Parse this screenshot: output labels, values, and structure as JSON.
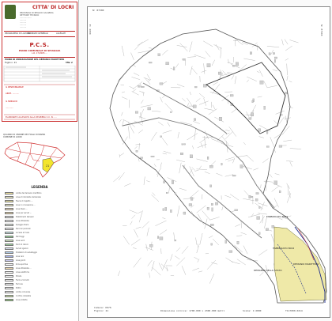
{
  "title_block": {
    "city": "CITTA' DI LOCRI",
    "header_lines": [
      "PROVINCIA DI REGGIO CALABRIA",
      "SETTORE TECNICO",
      "..................",
      "..........",
      "..........",
      "..........",
      ".........."
    ],
    "tabs": [
      "PROGRAMMA DI LAVORO",
      "INDIRIZZI GENERALI",
      "ALLEGATI"
    ],
    "pcs": "P.C.S.",
    "pcs_subtitle": "PIANO COMUNALE DI SPIAGGIA",
    "pcs_law": "L.R. 17/2005 ...",
    "sheet_title": "PIANO DI ZONIZZAZIONE DEL DEMANIO MARITTIMO",
    "sheet_code": "Foglio n. 21",
    "tav": "TAV. 2",
    "red_lines": [
      "IL RESPONSABILE",
      "ARCH. ..........",
      "IL SINDACO",
      "............"
    ],
    "bottom_note": "ELABORATO ALLEGATO ALLA DELIBERA C.C. N. ...."
  },
  "inset": {
    "title_lines": [
      "QUADRO DI UNIONE DEI FOGLI DI MAPPA",
      "COMUNE DI LOCRI"
    ],
    "highlight_label": "21",
    "colors": {
      "highlight": "#f3e52d",
      "outline": "#d03030"
    }
  },
  "legend": {
    "title": "LEGENDA",
    "items": [
      {
        "label": "Limite del demanio marittimo",
        "color": "#f6e9a0"
      },
      {
        "label": "Linea di dividente demaniale",
        "color": "#f4f1c8"
      },
      {
        "label": "Fascia di rispetto ...",
        "color": "#efe7a0"
      },
      {
        "label": "Aree in concessione ...",
        "color": "#f0efc8"
      },
      {
        "label": "Aree libere ...",
        "color": "#f2e2c4"
      },
      {
        "label": "Aree per servizi ...",
        "color": "#e9d6a8"
      },
      {
        "label": "Stabilimenti balneari",
        "color": "#e9e9e9"
      },
      {
        "label": "Aree attrezzate",
        "color": "#ffffff"
      },
      {
        "label": "Spiaggia libera",
        "color": "#e9f2e9"
      },
      {
        "label": "Percorsi pedonali",
        "color": "#ffffff"
      },
      {
        "label": "Accessi al mare",
        "color": "#c8e6e6"
      },
      {
        "label": "Parcheggi",
        "color": "#8fd08f"
      },
      {
        "label": "Aree verdi",
        "color": "#d6eec6"
      },
      {
        "label": "Punti di ristoro",
        "color": "#9fd69f"
      },
      {
        "label": "Servizi igienici",
        "color": "#dfe6f2"
      },
      {
        "label": "Postazioni di salvataggio",
        "color": "#b4d2f0"
      },
      {
        "label": "Area cani",
        "color": "#a8b4e8"
      },
      {
        "label": "Area giochi",
        "color": "#c8c8e8"
      },
      {
        "label": "Zona sportiva",
        "color": "#f0f0f0"
      },
      {
        "label": "Aree attrezzate ...",
        "color": "#ecd6b0"
      },
      {
        "label": "Linee elettriche",
        "color": "#ffffff"
      },
      {
        "label": "Strade",
        "color": "#ffffff"
      },
      {
        "label": "Fiumi e torrenti",
        "color": "#ffffff"
      },
      {
        "label": "Ferrovia",
        "color": "#ffffff"
      },
      {
        "label": "Edifici",
        "color": "#ffffff"
      },
      {
        "label": "Limite comunale",
        "color": "#ffffff"
      },
      {
        "label": "Confine catastale",
        "color": "#cde6a8"
      },
      {
        "label": "Aree protette",
        "color": "#8ec87a"
      }
    ]
  },
  "map": {
    "top_left_label": "N: 87300",
    "left_coord": "E: 4000",
    "right_top_coord": "N: 87300",
    "bottom_left": [
      "Comune: D976",
      "Foglio: 21"
    ],
    "bottom_center": "Dimensione cornice: 1700.000 x 2300.000 metri",
    "bottom_right": "Scala: 1:2000",
    "bottom_far_right": "T117000.0214",
    "labels": [
      "FABBRICATO 8001",
      "FABBRICATO 8002",
      "DEMANIO DELLO STATO",
      "DEMANIO MARITTIMO"
    ],
    "colors": {
      "parcel_line": "#9a9a9a",
      "road": "#7a7a7a",
      "demanio": "#efe9a8",
      "coast": "#1a2a8a"
    }
  }
}
